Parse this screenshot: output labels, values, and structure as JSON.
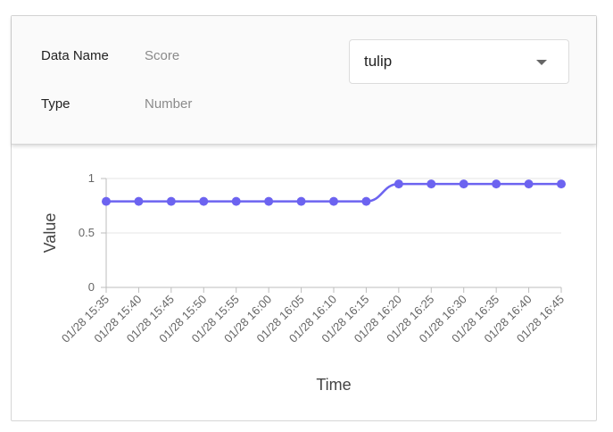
{
  "info": {
    "data_name_label": "Data Name",
    "data_name_value": "Score",
    "type_label": "Type",
    "type_value": "Number"
  },
  "selector": {
    "value": "tulip",
    "icon": "chevron-down-icon"
  },
  "colors": {
    "series": "#6c63f0",
    "grid": "#e5e5e5",
    "axis": "#bdbdbd"
  },
  "chart_data": {
    "type": "line",
    "xlabel": "Time",
    "ylabel": "Value",
    "ylim": [
      0,
      1
    ],
    "yticks": [
      "0",
      "0.5",
      "1"
    ],
    "grid": "horizontal",
    "categories": [
      "01/28 15:35",
      "01/28 15:40",
      "01/28 15:45",
      "01/28 15:50",
      "01/28 15:55",
      "01/28 16:00",
      "01/28 16:05",
      "01/28 16:10",
      "01/28 16:15",
      "01/28 16:20",
      "01/28 16:25",
      "01/28 16:30",
      "01/28 16:35",
      "01/28 16:40",
      "01/28 16:45"
    ],
    "series": [
      {
        "values": [
          0.79,
          0.79,
          0.79,
          0.79,
          0.79,
          0.79,
          0.79,
          0.79,
          0.79,
          0.95,
          0.95,
          0.95,
          0.95,
          0.95,
          0.95
        ]
      }
    ]
  }
}
